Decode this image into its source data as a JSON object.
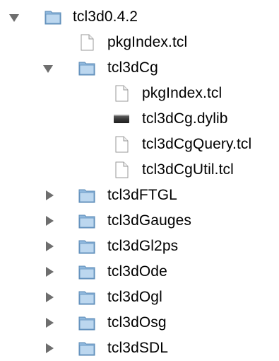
{
  "tree": {
    "items": [
      {
        "label": "tcl3d0.4.2",
        "icon": "folder-icon",
        "expanded": true
      },
      {
        "label": "pkgIndex.tcl",
        "icon": "document-icon"
      },
      {
        "label": "tcl3dCg",
        "icon": "folder-icon",
        "expanded": true
      },
      {
        "label": "pkgIndex.tcl",
        "icon": "document-icon"
      },
      {
        "label": "tcl3dCg.dylib",
        "icon": "library-icon"
      },
      {
        "label": "tcl3dCgQuery.tcl",
        "icon": "document-icon"
      },
      {
        "label": "tcl3dCgUtil.tcl",
        "icon": "document-icon"
      },
      {
        "label": "tcl3dFTGL",
        "icon": "folder-icon",
        "expanded": false
      },
      {
        "label": "tcl3dGauges",
        "icon": "folder-icon",
        "expanded": false
      },
      {
        "label": "tcl3dGl2ps",
        "icon": "folder-icon",
        "expanded": false
      },
      {
        "label": "tcl3dOde",
        "icon": "folder-icon",
        "expanded": false
      },
      {
        "label": "tcl3dOgl",
        "icon": "folder-icon",
        "expanded": false
      },
      {
        "label": "tcl3dOsg",
        "icon": "folder-icon",
        "expanded": false
      },
      {
        "label": "tcl3dSDL",
        "icon": "folder-icon",
        "expanded": false
      }
    ]
  }
}
